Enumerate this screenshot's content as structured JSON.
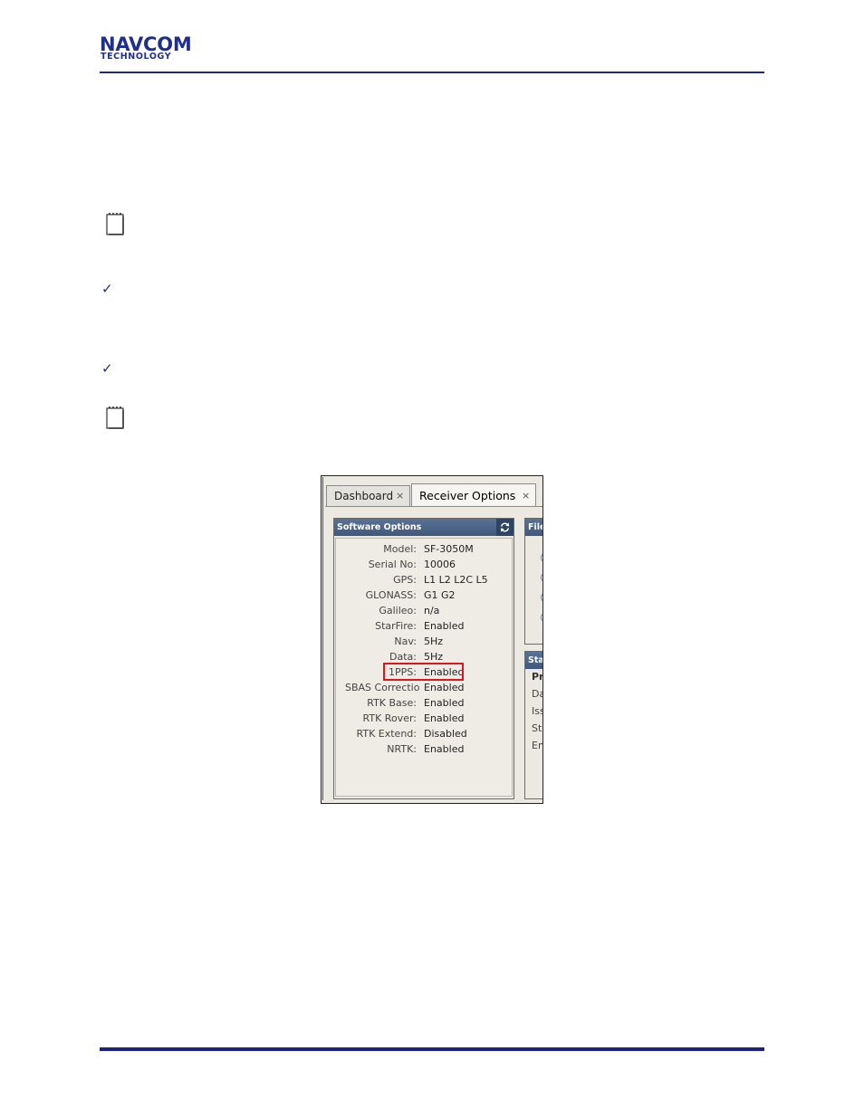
{
  "header": {
    "logo_main": "NAVCOM",
    "logo_sub": "TECHNOLOGY"
  },
  "screenshot": {
    "tabs": [
      {
        "label": "Dashboard",
        "close": "×"
      },
      {
        "label": "Receiver Options",
        "close": "×"
      }
    ],
    "software_options": {
      "title": "Software Options",
      "refresh_icon": "refresh-icon",
      "rows": [
        {
          "label": "Model:",
          "value": "SF-3050M"
        },
        {
          "label": "Serial No:",
          "value": "10006"
        },
        {
          "label": "GPS:",
          "value": "L1 L2 L2C L5"
        },
        {
          "label": "GLONASS:",
          "value": "G1 G2"
        },
        {
          "label": "Galileo:",
          "value": "n/a"
        },
        {
          "label": "StarFire:",
          "value": "Enabled"
        },
        {
          "label": "Nav:",
          "value": "5Hz"
        },
        {
          "label": "Data:",
          "value": "5Hz"
        },
        {
          "label": "1PPS:",
          "value": "Enabled"
        },
        {
          "label": "SBAS Corrections:",
          "value": "Enabled"
        },
        {
          "label": "RTK Base:",
          "value": "Enabled"
        },
        {
          "label": "RTK Rover:",
          "value": "Enabled"
        },
        {
          "label": "RTK Extend:",
          "value": "Disabled"
        },
        {
          "label": "NRTK:",
          "value": "Enabled"
        }
      ]
    },
    "file_panel": {
      "title": "File"
    },
    "status_panel": {
      "title": "Sta",
      "lines": [
        "Pr",
        "Da",
        "Iss",
        "St",
        "En"
      ]
    },
    "highlight_color": "#e0141a"
  }
}
